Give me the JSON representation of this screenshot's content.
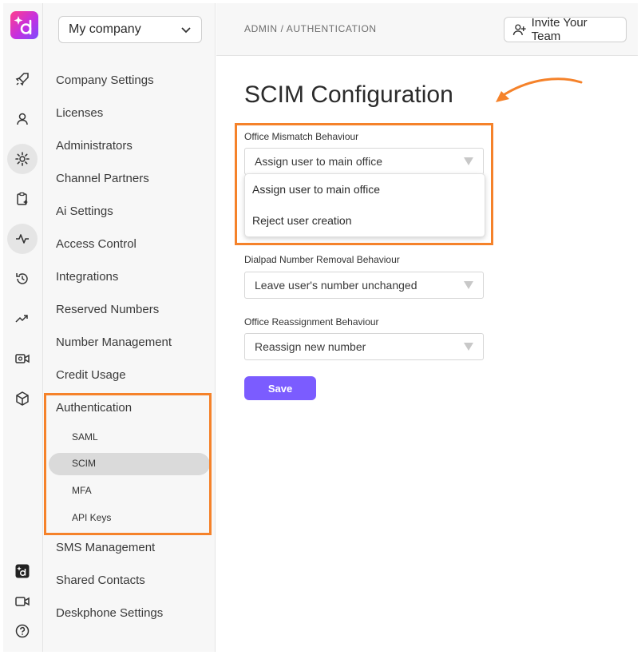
{
  "company_select": {
    "value": "My company"
  },
  "nav": {
    "items": [
      "Company Settings",
      "Licenses",
      "Administrators",
      "Channel Partners",
      "Ai Settings",
      "Access Control",
      "Integrations",
      "Reserved Numbers",
      "Number Management",
      "Credit Usage",
      "Authentication",
      "SMS Management",
      "Shared Contacts",
      "Deskphone Settings"
    ],
    "auth_sub": [
      "SAML",
      "SCIM",
      "MFA",
      "API Keys"
    ]
  },
  "header": {
    "breadcrumb": "ADMIN / AUTHENTICATION",
    "invite_label": "Invite Your Team"
  },
  "main": {
    "title": "SCIM Configuration",
    "mismatch": {
      "label": "Office Mismatch Behaviour",
      "value": "Assign user to main office",
      "options": [
        "Assign user to main office",
        "Reject user creation"
      ]
    },
    "removal": {
      "label": "Dialpad Number Removal Behaviour",
      "value": "Leave user's number unchanged"
    },
    "reassign": {
      "label": "Office Reassignment Behaviour",
      "value": "Reassign new number"
    },
    "save_label": "Save"
  },
  "rail_icons": [
    "rocket-icon",
    "person-icon",
    "gear-icon",
    "clipboard-sparkle-icon",
    "activity-icon",
    "history-icon",
    "trending-icon",
    "video-settings-icon",
    "cube-icon",
    "dialpad-ai-icon",
    "video-icon",
    "help-icon"
  ],
  "colors": {
    "accent": "#7b5cff",
    "highlight": "#f5822a"
  }
}
